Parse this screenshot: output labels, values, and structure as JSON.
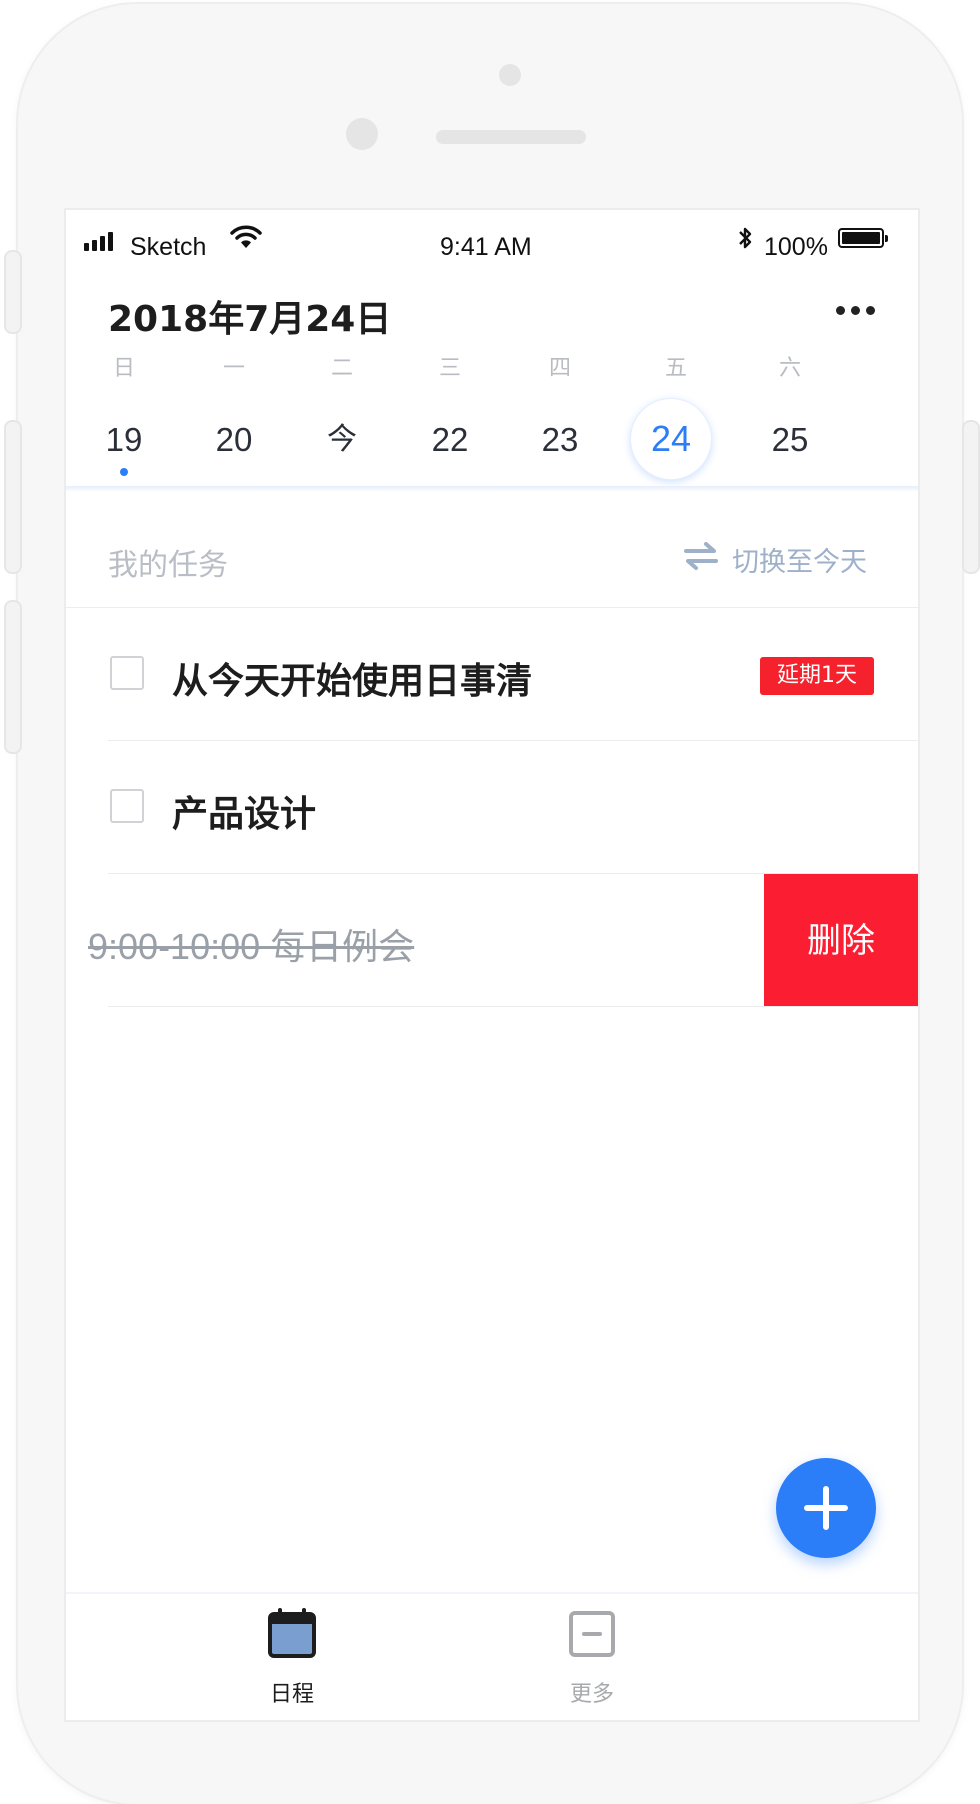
{
  "status_bar": {
    "carrier": "Sketch",
    "time": "9:41 AM",
    "battery": "100%"
  },
  "header": {
    "date_title": "2018年7月24日",
    "more_icon": "more-horizontal-icon"
  },
  "week": {
    "weekdays": [
      "日",
      "一",
      "二",
      "三",
      "四",
      "五",
      "六"
    ],
    "days": [
      "19",
      "20",
      "今",
      "22",
      "23",
      "24",
      "25"
    ],
    "selected_day": "24",
    "dot_day": "19"
  },
  "section": {
    "title": "我的任务",
    "switch_label": "切换至今天",
    "switch_icon": "swap-arrows-icon"
  },
  "tasks": [
    {
      "title": "从今天开始使用日事清",
      "tag": "延期1天"
    },
    {
      "title": "产品设计"
    }
  ],
  "completed_task": {
    "title": "9:00-10:00 每日例会",
    "delete_label": "删除"
  },
  "tab_bar": {
    "items": [
      {
        "label": "日程",
        "icon": "calendar-icon",
        "active": true
      },
      {
        "label": "更多",
        "icon": "more-box-icon",
        "active": false
      }
    ]
  },
  "colors": {
    "accent": "#2b7ef8",
    "danger": "#f5222d",
    "delete": "#fb1d31"
  }
}
